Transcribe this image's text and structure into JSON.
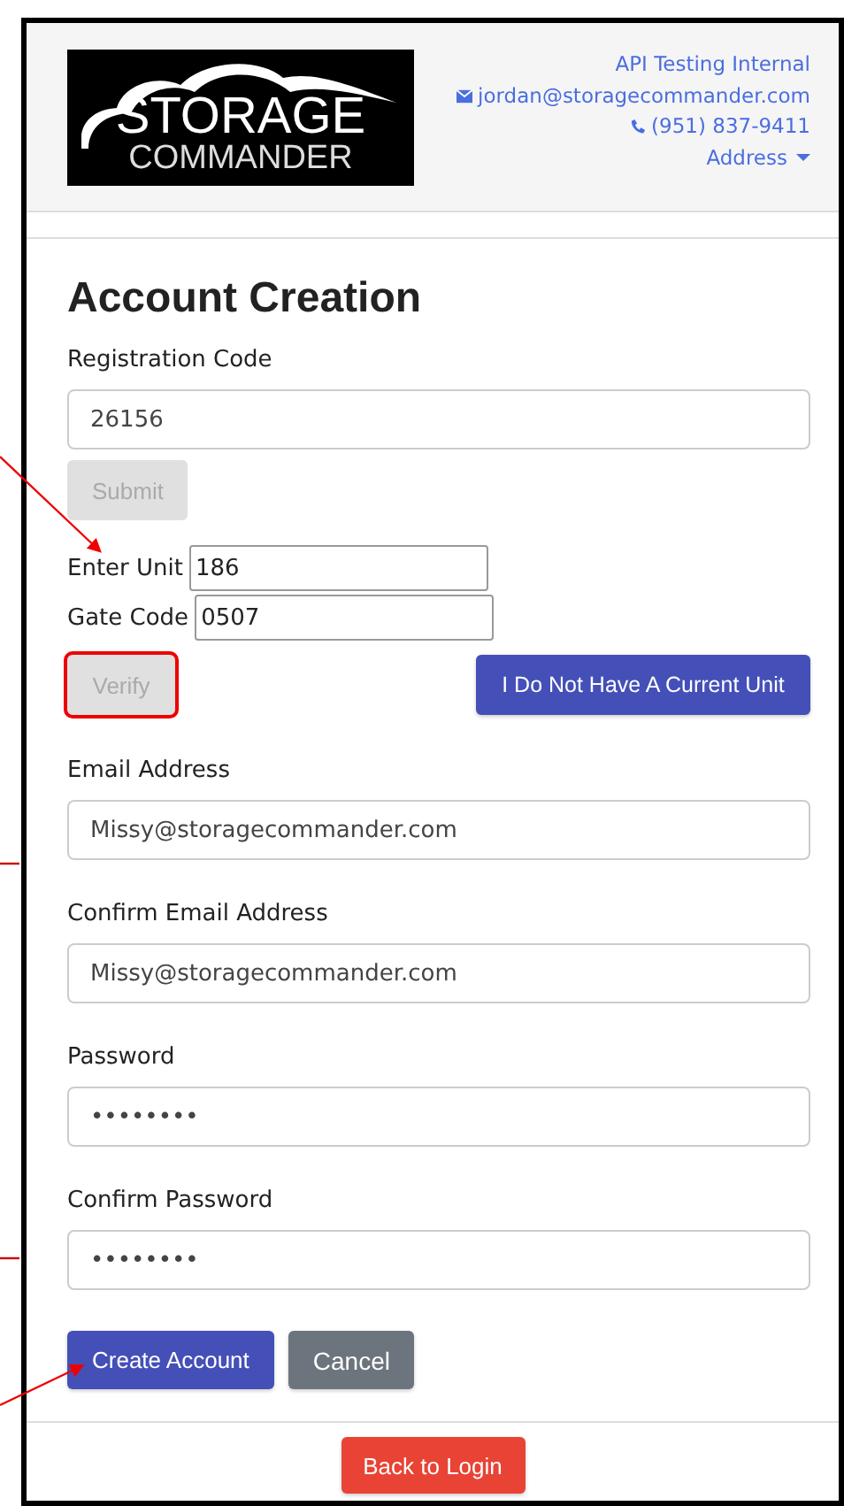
{
  "header": {
    "logo": {
      "line_1": "STORAGE",
      "line_2": "COMMANDER"
    },
    "company": "API Testing Internal",
    "email": "jordan@storagecommander.com",
    "phone": "(951) 837-9411",
    "address_menu": "Address"
  },
  "form": {
    "title": "Account Creation",
    "registration": {
      "label": "Registration Code",
      "value": "26156"
    },
    "submit": {
      "label": "Submit",
      "disabled": true
    },
    "unit": {
      "label": "Enter Unit",
      "value": "186"
    },
    "gate": {
      "label": "Gate Code",
      "value": "0507"
    },
    "verify": {
      "label": "Verify",
      "disabled": true,
      "highlighted": true
    },
    "no_unit": {
      "label": "I Do Not Have A Current Unit"
    },
    "fields": [
      {
        "label": "Email Address",
        "value": "Missy@storagecommander.com"
      },
      {
        "label": "Confirm Email Address",
        "value": "Missy@storagecommander.com"
      },
      {
        "label": "Password",
        "value": "••••••••"
      },
      {
        "label": "Confirm Password",
        "value": "••••••••"
      }
    ],
    "actions": [
      {
        "label": "Create Account",
        "kind": "primary"
      },
      {
        "label": "Cancel",
        "kind": "secondary"
      }
    ]
  },
  "back_button": {
    "label": "Back to Login"
  }
}
